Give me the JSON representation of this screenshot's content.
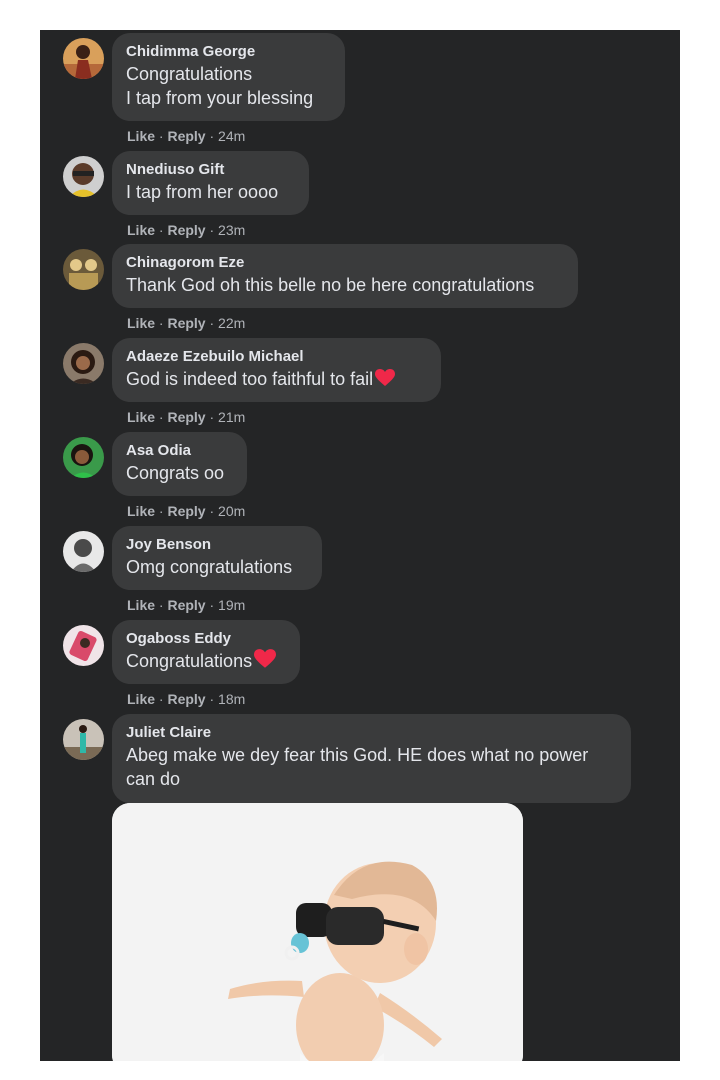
{
  "comments": [
    {
      "author": "Chidimma George",
      "lines": [
        "Congratulations",
        "I tap from your blessing"
      ],
      "like": "Like",
      "reply": "Reply",
      "time": "24m",
      "avatar": "avatar-photo"
    },
    {
      "author": "Nnediuso Gift",
      "lines": [
        "I tap from her oooo"
      ],
      "like": "Like",
      "reply": "Reply",
      "time": "23m",
      "avatar": "avatar-photo"
    },
    {
      "author": "Chinagorom Eze",
      "lines": [
        "Thank God oh this belle no be here congratulations"
      ],
      "like": "Like",
      "reply": "Reply",
      "time": "22m",
      "avatar": "avatar-photo"
    },
    {
      "author": "Adaeze Ezebuilo Michael",
      "lines": [
        "God is indeed too faithful to fail"
      ],
      "like": "Like",
      "reply": "Reply",
      "time": "21m",
      "avatar": "avatar-photo"
    },
    {
      "author": "Asa Odia",
      "lines": [
        "Congrats oo"
      ],
      "like": "Like",
      "reply": "Reply",
      "time": "20m",
      "avatar": "avatar-photo"
    },
    {
      "author": "Joy Benson",
      "lines": [
        "Omg congratulations"
      ],
      "like": "Like",
      "reply": "Reply",
      "time": "19m",
      "avatar": "avatar-photo"
    },
    {
      "author": "Ogaboss Eddy",
      "lines": [
        "Congratulations"
      ],
      "like": "Like",
      "reply": "Reply",
      "time": "18m",
      "avatar": "avatar-photo"
    },
    {
      "author": "Juliet Claire",
      "lines": [
        "Abeg make we dey fear this God. HE does what no power",
        "can do"
      ],
      "avatar": "avatar-photo"
    }
  ],
  "separator": "·",
  "icons": {
    "heart": "heart-icon",
    "gif": "baby-sunglasses-gif"
  },
  "colors": {
    "panel": "#242526",
    "bubble": "#3a3b3c",
    "text": "#e4e6eb",
    "meta": "#b0b3b8",
    "heart": "#f02849"
  }
}
